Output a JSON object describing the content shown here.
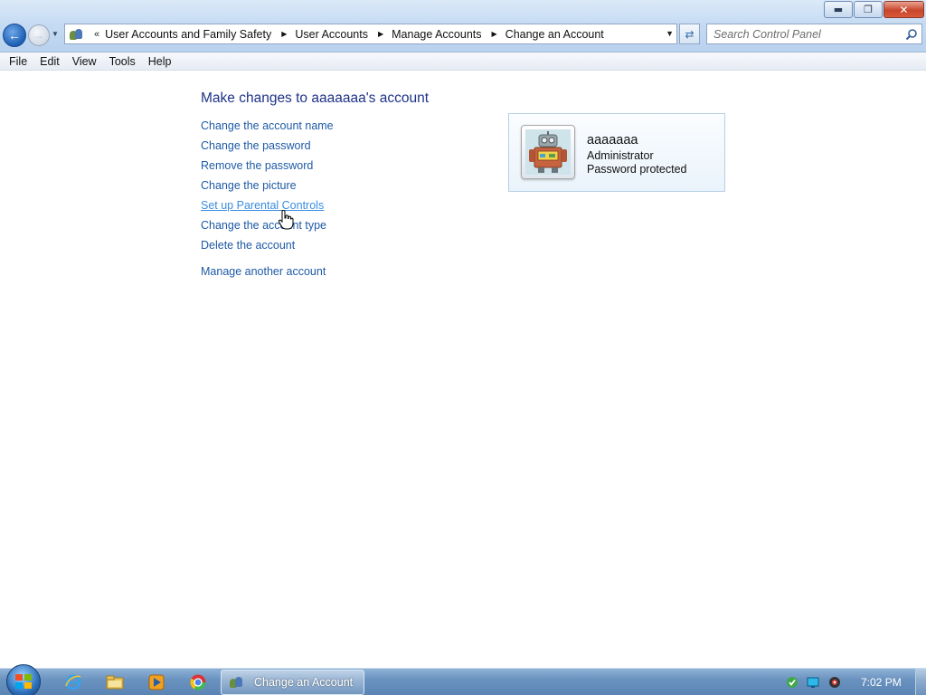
{
  "window": {
    "controls": {
      "minimize_glyph": "▬",
      "maximize_glyph": "❐",
      "close_glyph": "✕"
    }
  },
  "address_bar": {
    "overflow": "«",
    "crumbs": [
      "User Accounts and Family Safety",
      "User Accounts",
      "Manage Accounts",
      "Change an Account"
    ]
  },
  "search": {
    "placeholder": "Search Control Panel",
    "value": ""
  },
  "menu": {
    "items": [
      "File",
      "Edit",
      "View",
      "Tools",
      "Help"
    ]
  },
  "main": {
    "heading": "Make changes to aaaaaaa's account",
    "links": [
      "Change the account name",
      "Change the password",
      "Remove the password",
      "Change the picture",
      "Set up Parental Controls",
      "Change the account type",
      "Delete the account"
    ],
    "manage_link": "Manage another account",
    "hovered_link_index": 4
  },
  "account": {
    "name": "aaaaaaa",
    "type": "Administrator",
    "status": "Password protected",
    "picture": "robot-icon"
  },
  "taskbar": {
    "pinned": [
      "internet-explorer-icon",
      "windows-explorer-icon",
      "media-player-icon",
      "chrome-icon"
    ],
    "active_task": "Change an Account",
    "clock": "7:02 PM",
    "tray": [
      "security-check-icon",
      "network-icon",
      "volume-icon"
    ]
  },
  "colors": {
    "link": "#1e5aa6",
    "link_hover": "#3a8de0",
    "heading": "#1e3287",
    "taskbar": "#5a84b4"
  }
}
